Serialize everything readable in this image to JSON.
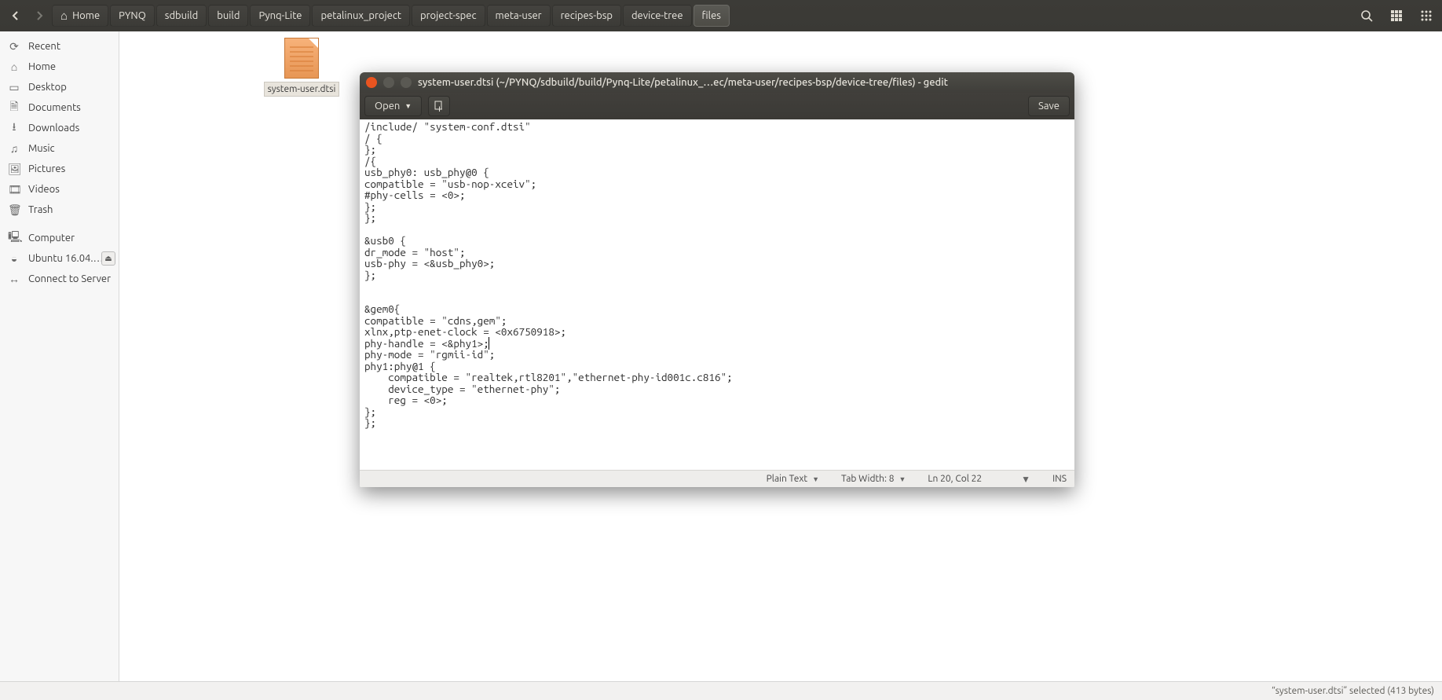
{
  "toolbar": {
    "breadcrumbs": [
      "Home",
      "PYNQ",
      "sdbuild",
      "build",
      "Pynq-Lite",
      "petalinux_project",
      "project-spec",
      "meta-user",
      "recipes-bsp",
      "device-tree",
      "files"
    ],
    "active_crumb_index": 10
  },
  "sidebar": {
    "items": [
      {
        "icon": "⟳",
        "label": "Recent"
      },
      {
        "icon": "⌂",
        "label": "Home"
      },
      {
        "icon": "▭",
        "label": "Desktop"
      },
      {
        "icon": "🗎",
        "label": "Documents"
      },
      {
        "icon": "⭳",
        "label": "Downloads"
      },
      {
        "icon": "♫",
        "label": "Music"
      },
      {
        "icon": "🖼",
        "label": "Pictures"
      },
      {
        "icon": "🎞",
        "label": "Videos"
      },
      {
        "icon": "🗑",
        "label": "Trash"
      }
    ],
    "items2": [
      {
        "icon": "🖳",
        "label": "Computer"
      },
      {
        "icon": "◒",
        "label": "Ubuntu 16.04.…",
        "eject": true
      },
      {
        "icon": "↔",
        "label": "Connect to Server"
      }
    ]
  },
  "file": {
    "name": "system-user.dtsi"
  },
  "status": {
    "text": "“system-user.dtsi” selected  (413 bytes)"
  },
  "gedit": {
    "title": "system-user.dtsi (~/PYNQ/sdbuild/build/Pynq-Lite/petalinux_…ec/meta-user/recipes-bsp/device-tree/files) - gedit",
    "open": "Open",
    "save": "Save",
    "content": "/include/ \"system-conf.dtsi\"\n/ {\n};\n/{\nusb_phy0: usb_phy@0 {\ncompatible = \"usb-nop-xceiv\";\n#phy-cells = <0>;\n};\n};\n\n&usb0 {\ndr_mode = \"host\";\nusb-phy = <&usb_phy0>;\n};\n\n\n&gem0{\ncompatible = \"cdns,gem\";\nxlnx,ptp-enet-clock = <0x6750918>;\nphy-handle = <&phy1>;\nphy-mode = \"rgmii-id\";\nphy1:phy@1 {\n    compatible = \"realtek,rtl8201\",\"ethernet-phy-id001c.c816\";\n    device_type = \"ethernet-phy\";\n    reg = <0>;\n};\n};",
    "statusbar": {
      "lang": "Plain Text",
      "tab": "Tab Width: 8",
      "pos": "Ln 20, Col 22",
      "ins": "INS"
    }
  }
}
